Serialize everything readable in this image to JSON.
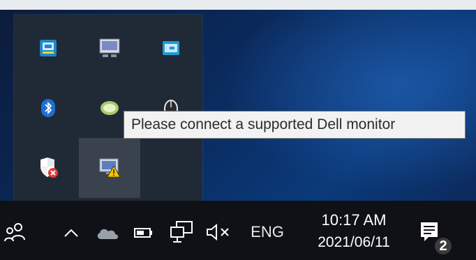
{
  "tray": {
    "icons": [
      {
        "name": "intel-graphics-icon"
      },
      {
        "name": "display-manager-icon"
      },
      {
        "name": "card-icon"
      },
      {
        "name": "bluetooth-icon"
      },
      {
        "name": "nvidia-icon"
      },
      {
        "name": "mouse-icon"
      },
      {
        "name": "security-shield-warning-icon"
      },
      {
        "name": "dell-display-manager-warning-icon"
      }
    ]
  },
  "tooltip": {
    "text": "Please connect a supported Dell monitor"
  },
  "taskbar": {
    "language": "ENG",
    "time": "10:17 AM",
    "date": "2021/06/11",
    "notification_count": "2"
  },
  "colors": {
    "taskbar_bg": "#0f1116",
    "flyout_bg": "#1f2a36",
    "tooltip_bg": "#f2f2f2",
    "warning_yellow": "#f5c400",
    "bluetooth_blue": "#1f6fd1",
    "shield_red": "#e33a3a"
  }
}
